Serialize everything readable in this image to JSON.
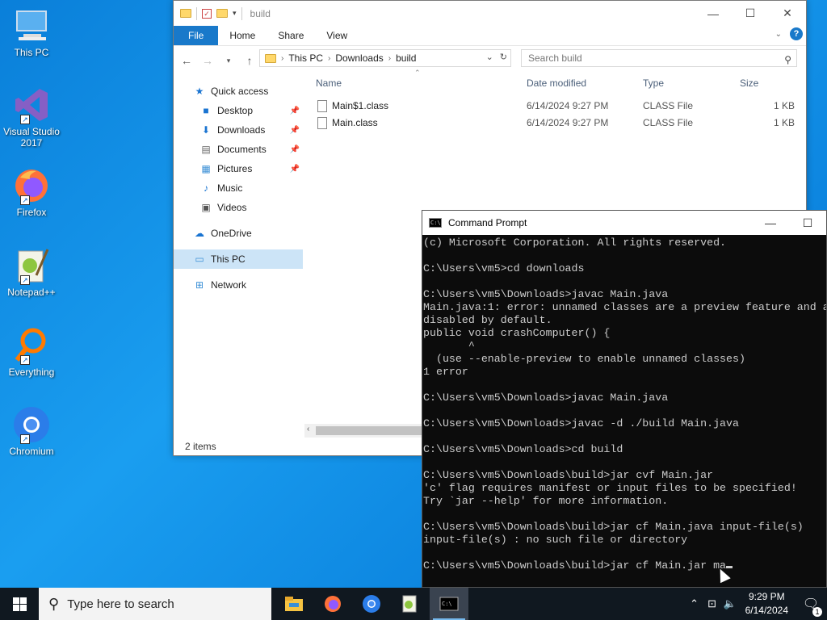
{
  "desktop": {
    "icons": [
      {
        "label": "This PC",
        "icon": "this-pc-icon"
      },
      {
        "label": "Visual Studio 2017",
        "icon": "visual-studio-icon"
      },
      {
        "label": "Firefox",
        "icon": "firefox-icon"
      },
      {
        "label": "Notepad++",
        "icon": "notepad-plus-plus-icon"
      },
      {
        "label": "Everything",
        "icon": "everything-search-icon"
      },
      {
        "label": "Chromium",
        "icon": "chromium-icon"
      }
    ]
  },
  "explorer": {
    "title": "build",
    "ribbon_tabs": [
      "File",
      "Home",
      "Share",
      "View"
    ],
    "breadcrumb": [
      "This PC",
      "Downloads",
      "build"
    ],
    "search_placeholder": "Search build",
    "nav": {
      "quick_access": "Quick access",
      "items": [
        "Desktop",
        "Downloads",
        "Documents",
        "Pictures",
        "Music",
        "Videos"
      ],
      "onedrive": "OneDrive",
      "this_pc": "This PC",
      "network": "Network"
    },
    "columns": [
      "Name",
      "Date modified",
      "Type",
      "Size"
    ],
    "files": [
      {
        "name": "Main$1.class",
        "date": "6/14/2024 9:27 PM",
        "type": "CLASS File",
        "size": "1 KB"
      },
      {
        "name": "Main.class",
        "date": "6/14/2024 9:27 PM",
        "type": "CLASS File",
        "size": "1 KB"
      }
    ],
    "status": "2 items"
  },
  "cmd": {
    "title": "Command Prompt",
    "lines": "(c) Microsoft Corporation. All rights reserved.\n\nC:\\Users\\vm5>cd downloads\n\nC:\\Users\\vm5\\Downloads>javac Main.java\nMain.java:1: error: unnamed classes are a preview feature and a\ndisabled by default.\npublic void crashComputer() {\n       ^\n  (use --enable-preview to enable unnamed classes)\n1 error\n\nC:\\Users\\vm5\\Downloads>javac Main.java\n\nC:\\Users\\vm5\\Downloads>javac -d ./build Main.java\n\nC:\\Users\\vm5\\Downloads>cd build\n\nC:\\Users\\vm5\\Downloads\\build>jar cvf Main.jar\n'c' flag requires manifest or input files to be specified!\nTry `jar --help' for more information.\n\nC:\\Users\\vm5\\Downloads\\build>jar cf Main.java input-file(s)\ninput-file(s) : no such file or directory\n\nC:\\Users\\vm5\\Downloads\\build>jar cf Main.jar ma"
  },
  "taskbar": {
    "search_placeholder": "Type here to search",
    "time": "9:29 PM",
    "date": "6/14/2024",
    "notification_count": "1"
  }
}
